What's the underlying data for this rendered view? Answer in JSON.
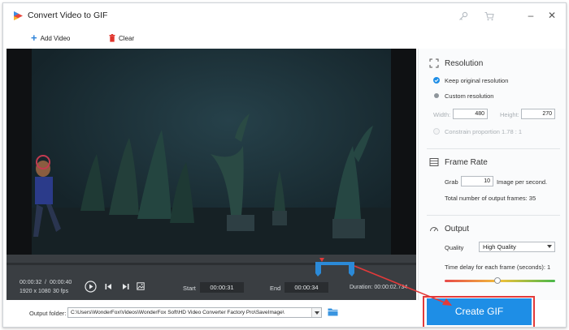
{
  "window": {
    "title": "Convert Video to GIF"
  },
  "toolbar": {
    "add_video_label": "Add Video",
    "clear_label": "Clear"
  },
  "player": {
    "current_time": "00:00:32",
    "separator": "/",
    "total_time": "00:00:40",
    "resolution": "1920 x 1080",
    "fps": "30 fps",
    "start_label": "Start",
    "start_time": "00:00:31",
    "end_label": "End",
    "end_time": "00:00:34",
    "duration_text": "Duration: 00:00:02.734"
  },
  "output": {
    "folder_label": "Output folder:",
    "folder_path": "C:\\Users\\WonderFox\\Videos\\WonderFox Soft\\HD Video Converter Factory Pro\\SaveImage\\"
  },
  "resolution_section": {
    "title": "Resolution",
    "keep_original_label": "Keep original resolution",
    "custom_label": "Custom resolution",
    "width_label": "Width:",
    "width_value": "480",
    "height_label": "Height:",
    "height_value": "270",
    "constrain_label": "Constrain proportion  1.78 : 1"
  },
  "frame_rate_section": {
    "title": "Frame Rate",
    "grab_label": "Grab",
    "grab_value": "10",
    "per_second_label": "Image per second.",
    "total_frames_text": "Total number of output frames:  35"
  },
  "output_section": {
    "title": "Output",
    "quality_label": "Quality",
    "quality_value": "High Quality",
    "delay_label": "Time delay for each frame (seconds):  1",
    "delay_slider_level": 0.48
  },
  "create_button_label": "Create GIF",
  "colors": {
    "accent": "#1e8ee6",
    "highlight": "#e23a3a",
    "clip": "#2b8ad8"
  }
}
